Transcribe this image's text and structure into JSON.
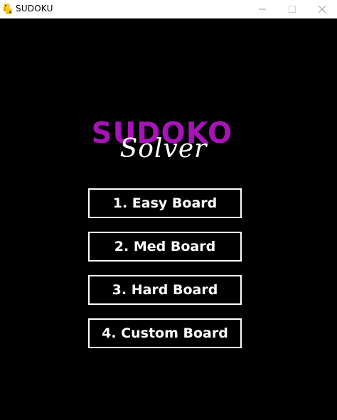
{
  "window": {
    "title": "SUDOKU",
    "app_icon": "python-snake-icon",
    "controls": {
      "minimize_icon": "minimize-icon",
      "maximize_icon": "maximize-icon",
      "close_icon": "close-icon"
    }
  },
  "logo": {
    "title": "SUDOKO",
    "subtitle": "Solver",
    "title_color": "#a713b7",
    "subtitle_color": "#ffffff"
  },
  "menu": {
    "items": [
      {
        "label": "1. Easy Board"
      },
      {
        "label": "2. Med Board"
      },
      {
        "label": "3. Hard Board"
      },
      {
        "label": "4. Custom Board"
      }
    ]
  },
  "colors": {
    "background": "#000000",
    "titlebar": "#ffffff",
    "button_border": "#ffffff",
    "button_text": "#ffffff"
  }
}
